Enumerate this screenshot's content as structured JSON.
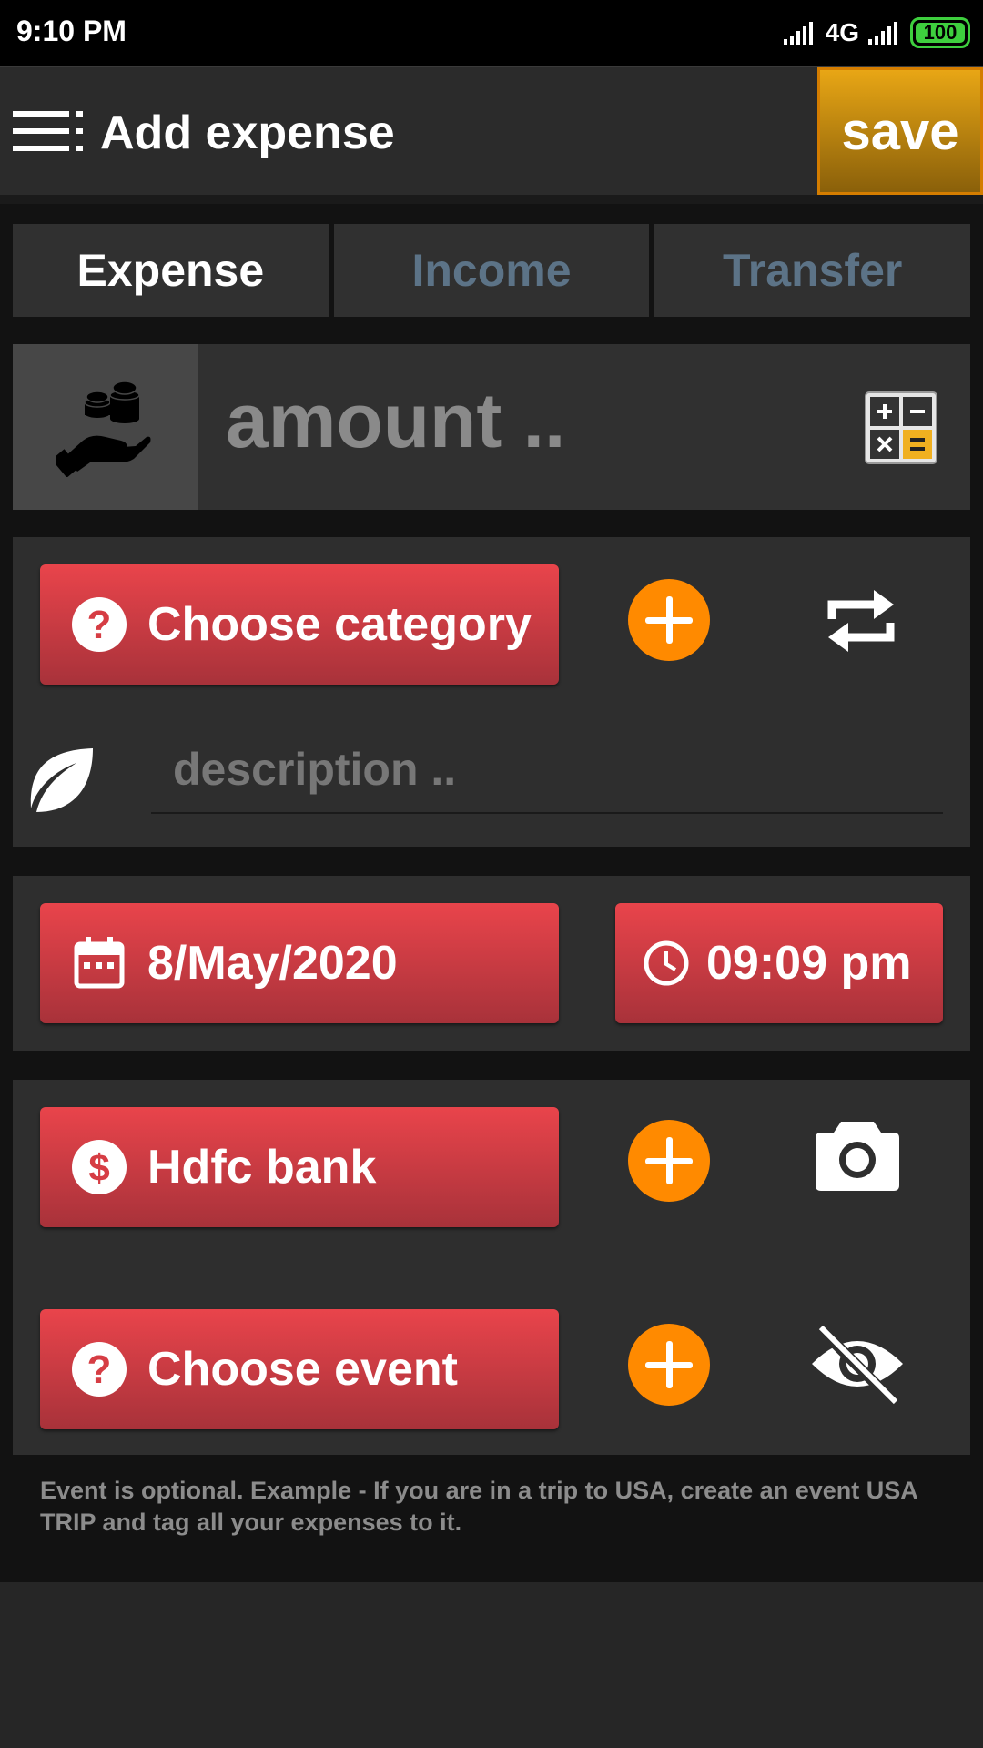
{
  "status_bar": {
    "time": "9:10 PM",
    "network": "4G",
    "battery": "100"
  },
  "app_bar": {
    "title": "Add expense",
    "save_label": "save"
  },
  "tabs": [
    {
      "label": "Expense",
      "active": true
    },
    {
      "label": "Income",
      "active": false
    },
    {
      "label": "Transfer",
      "active": false
    }
  ],
  "amount": {
    "placeholder": "amount .."
  },
  "category": {
    "label": "Choose category"
  },
  "description": {
    "placeholder": "description .."
  },
  "date": {
    "label": "8/May/2020"
  },
  "time": {
    "label": "09:09 pm"
  },
  "account": {
    "label": "Hdfc bank"
  },
  "event": {
    "label": "Choose event"
  },
  "footnote": "Event is optional. Example - If you are in a trip to USA, create an event USA TRIP and tag all your expenses to it.",
  "colors": {
    "accent_red": "#e9444b",
    "accent_orange": "#ff8a00",
    "save_gold": "#e8a615",
    "tab_inactive": "#5c7387"
  }
}
